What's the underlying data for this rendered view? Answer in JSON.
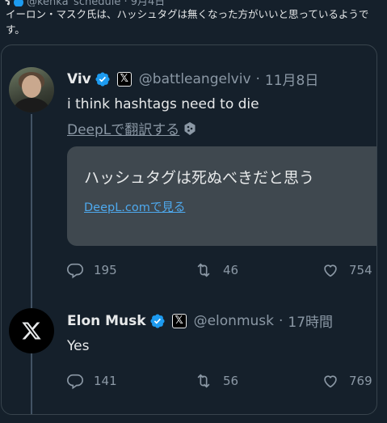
{
  "caption": "イーロン・マスク氏は、ハッシュタグは無くなった方がいいと思っているようです。",
  "tweets": [
    {
      "author": "Viv",
      "handle": "@battleangelviv",
      "dot": "·",
      "date": "11月8日",
      "text": "i think hashtags need to die",
      "translate_link": "DeepLで翻訳する",
      "translation": {
        "text": "ハッシュタグは死ぬべきだと思う",
        "link": "DeepL.comで見る"
      },
      "replies": "195",
      "retweets": "46",
      "likes": "754"
    },
    {
      "author": "Elon Musk",
      "handle": "@elonmusk",
      "dot": "·",
      "date": "17時間",
      "text": "Yes",
      "replies": "141",
      "retweets": "56",
      "likes": "769"
    }
  ],
  "colors": {
    "background": "#15202b",
    "verified": "#1d9bf0",
    "muted": "#8b98a5",
    "link": "#4ea9ee"
  },
  "icons": [
    "verified-badge-icon",
    "x-logo-icon",
    "deepl-icon",
    "reply-icon",
    "retweet-icon",
    "like-icon"
  ]
}
